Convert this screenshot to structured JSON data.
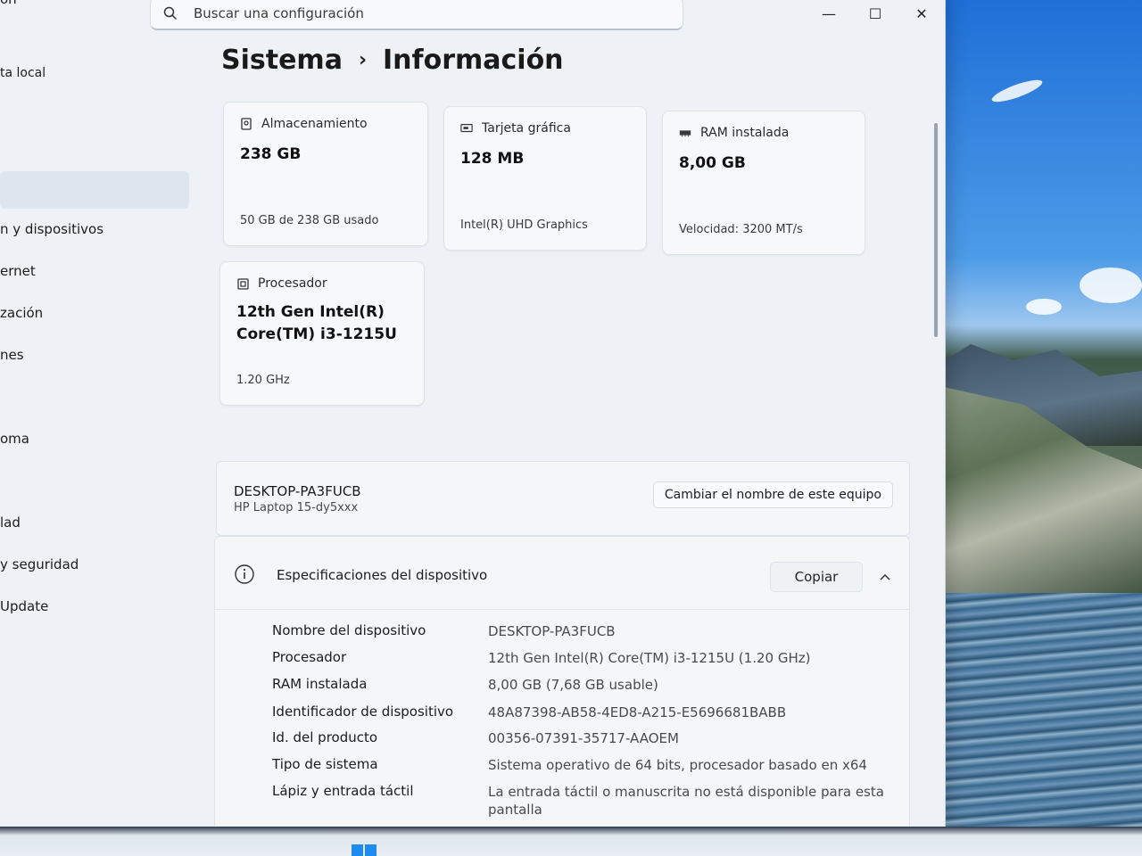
{
  "window": {
    "controls": {
      "minimize": "—",
      "maximize": "☐",
      "close": "✕"
    }
  },
  "search": {
    "placeholder": "Buscar una configuración"
  },
  "sidebar": {
    "items": [
      {
        "label": "ón"
      },
      {
        "label": "ta local"
      },
      {
        "label": "n y dispositivos"
      },
      {
        "label": "ernet"
      },
      {
        "label": "zación"
      },
      {
        "label": "nes"
      },
      {
        "label": "oma"
      },
      {
        "label": "lad"
      },
      {
        "label": "y seguridad"
      },
      {
        "label": "Update"
      }
    ]
  },
  "breadcrumb": {
    "parent": "Sistema",
    "separator": "›",
    "current": "Información"
  },
  "cards": {
    "storage": {
      "title": "Almacenamiento",
      "value": "238 GB",
      "sub": "50 GB de 238 GB usado"
    },
    "gpu": {
      "title": "Tarjeta gráfica",
      "value": "128 MB",
      "sub": "Intel(R) UHD Graphics"
    },
    "ram": {
      "title": "RAM instalada",
      "value": "8,00 GB",
      "sub": "Velocidad: 3200 MT/s"
    },
    "cpu": {
      "title": "Procesador",
      "value_line1": "12th Gen Intel(R)",
      "value_line2": "Core(TM) i3-1215U",
      "sub": "1.20 GHz"
    }
  },
  "device": {
    "name": "DESKTOP-PA3FUCB",
    "model": "HP Laptop 15-dy5xxx",
    "rename_label": "Cambiar el nombre de este equipo"
  },
  "specs": {
    "title": "Especificaciones del dispositivo",
    "copy_label": "Copiar",
    "rows": [
      {
        "key": "Nombre del dispositivo",
        "value": "DESKTOP-PA3FUCB"
      },
      {
        "key": "Procesador",
        "value": "12th Gen Intel(R) Core(TM) i3-1215U (1.20 GHz)"
      },
      {
        "key": "RAM instalada",
        "value": "8,00 GB (7,68 GB usable)"
      },
      {
        "key": "Identificador de dispositivo",
        "value": "48A87398-AB58-4ED8-A215-E5696681BABB"
      },
      {
        "key": "Id. del producto",
        "value": "00356-07391-35717-AAOEM"
      },
      {
        "key": "Tipo de sistema",
        "value": "Sistema operativo de 64 bits, procesador basado en x64"
      },
      {
        "key": "Lápiz y entrada táctil",
        "value": "La entrada táctil o manuscrita no está disponible para esta pantalla"
      }
    ]
  }
}
